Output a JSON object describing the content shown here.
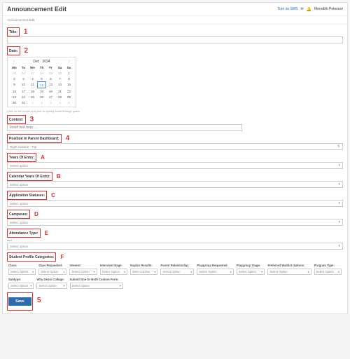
{
  "header": {
    "title": "Announcement Edit",
    "sms": "Turn on SMS",
    "sms_icon": "✉",
    "user": "Meredith Peterson"
  },
  "breadcrumb": "Announcement Edit",
  "labels": {
    "title": "Title:",
    "date": "Date:",
    "content": "Content:",
    "position": "Position In Parent Dashboard:",
    "yoe": "Years Of Entry:",
    "cyoe": "Calendar Years Of Entry:",
    "appstat": "Application Statuses:",
    "campuses": "Campuses:",
    "atttype": "Attendance Type:",
    "spc": "Student Profile Categories:"
  },
  "markers": {
    "m1": "1",
    "m2": "2",
    "m3": "3",
    "m4": "4",
    "m5": "5",
    "mA": "A",
    "mB": "B",
    "mC": "C",
    "mD": "D",
    "mE": "E",
    "mF": "F"
  },
  "calendar": {
    "month": "Dec",
    "year": "2024",
    "prev": "‹",
    "next": "›",
    "dh": [
      "Mo",
      "Tu",
      "We",
      "Th",
      "Fr",
      "Sa",
      "Su"
    ],
    "cells": [
      {
        "t": "25",
        "m": true
      },
      {
        "t": "26",
        "m": true
      },
      {
        "t": "27",
        "m": true
      },
      {
        "t": "28",
        "m": true
      },
      {
        "t": "29",
        "m": true
      },
      {
        "t": "30",
        "m": true
      },
      {
        "t": "1"
      },
      {
        "t": "2"
      },
      {
        "t": "3"
      },
      {
        "t": "4"
      },
      {
        "t": "5"
      },
      {
        "t": "6"
      },
      {
        "t": "7"
      },
      {
        "t": "8"
      },
      {
        "t": "9"
      },
      {
        "t": "10"
      },
      {
        "t": "11"
      },
      {
        "t": "12",
        "s": true
      },
      {
        "t": "13"
      },
      {
        "t": "14"
      },
      {
        "t": "15"
      },
      {
        "t": "16"
      },
      {
        "t": "17"
      },
      {
        "t": "18"
      },
      {
        "t": "19"
      },
      {
        "t": "20"
      },
      {
        "t": "21"
      },
      {
        "t": "22"
      },
      {
        "t": "23"
      },
      {
        "t": "24"
      },
      {
        "t": "25"
      },
      {
        "t": "26"
      },
      {
        "t": "27"
      },
      {
        "t": "28"
      },
      {
        "t": "29"
      },
      {
        "t": "30"
      },
      {
        "t": "31"
      },
      {
        "t": "1",
        "m": true
      },
      {
        "t": "2",
        "m": true
      },
      {
        "t": "3",
        "m": true
      },
      {
        "t": "4",
        "m": true
      },
      {
        "t": "5",
        "m": true
      }
    ],
    "note": "Click on the month and year to quickly scroll through years."
  },
  "placeholders": {
    "content": "Insert text here ...",
    "select": "Select option",
    "selopt": "Select Option"
  },
  "position_value": "Right Column - Top",
  "att_pre": "and",
  "columns": {
    "r1": [
      "Class:",
      "Days Requested:",
      "Interest:",
      "Interview Stage:",
      "Naplan Results:",
      "Parent Relationship:",
      "Playgroup Requested:",
      "Playgroup Stage:",
      "Preferred Waitlist Options:",
      "Program Type:"
    ],
    "r2": [
      "Subtype:",
      "Why Demo College:",
      "Submit One Or Both Custom Form:"
    ]
  },
  "save": "Save",
  "chev": "▾"
}
